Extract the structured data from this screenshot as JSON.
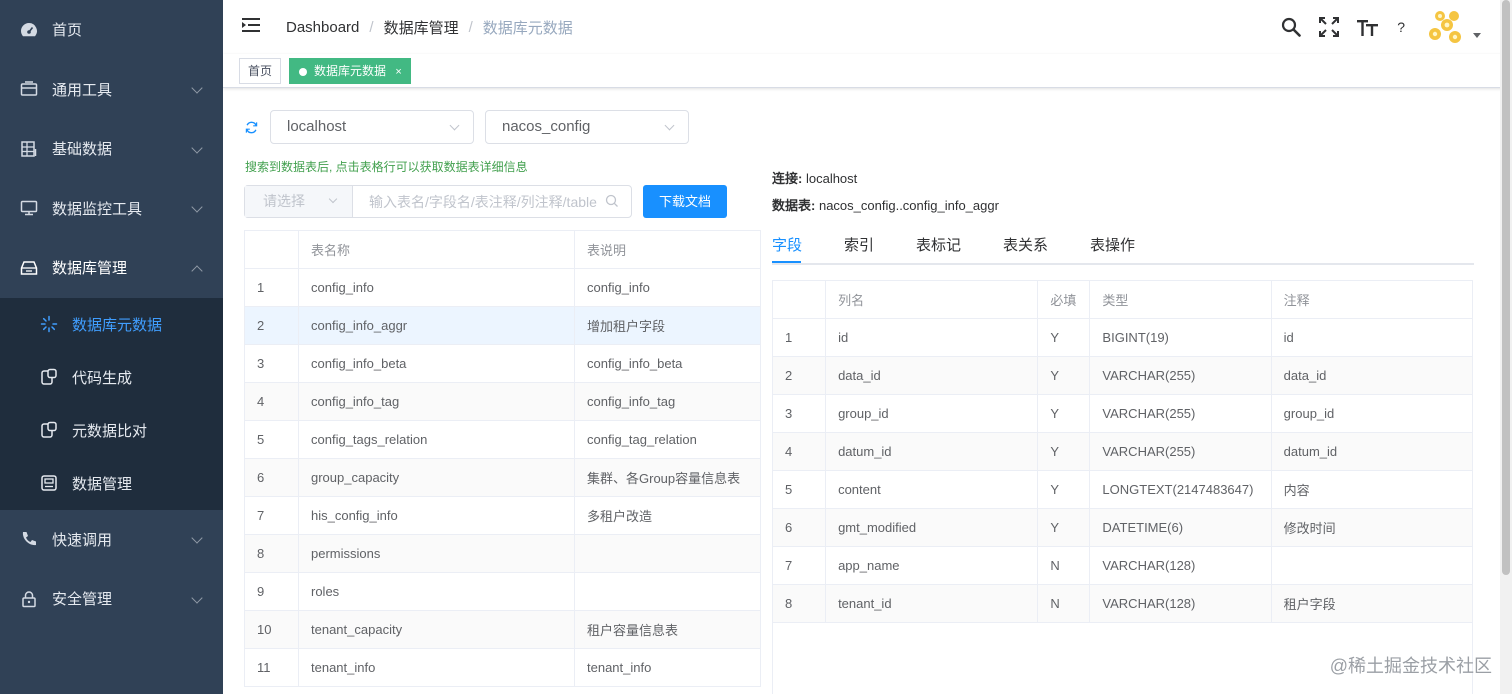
{
  "sidebar": {
    "items": [
      {
        "label": "首页",
        "icon": "dashboard-icon"
      },
      {
        "label": "通用工具",
        "icon": "tools-icon"
      },
      {
        "label": "基础数据",
        "icon": "table-icon"
      },
      {
        "label": "数据监控工具",
        "icon": "monitor-icon"
      },
      {
        "label": "数据库管理",
        "icon": "database-icon"
      }
    ],
    "subitems": [
      {
        "label": "数据库元数据",
        "icon": "sparkle-icon"
      },
      {
        "label": "代码生成",
        "icon": "code-icon"
      },
      {
        "label": "元数据比对",
        "icon": "compare-icon"
      },
      {
        "label": "数据管理",
        "icon": "data-icon"
      }
    ],
    "bottom_items": [
      {
        "label": "快速调用",
        "icon": "phone-icon"
      },
      {
        "label": "安全管理",
        "icon": "lock-icon"
      }
    ]
  },
  "header": {
    "breadcrumb": [
      "Dashboard",
      "数据库管理",
      "数据库元数据"
    ],
    "sep": "/",
    "help": "?"
  },
  "tags": {
    "home": "首页",
    "active": "数据库元数据",
    "close": "×"
  },
  "filters": {
    "connection": "localhost",
    "database": "nacos_config",
    "hint": "搜索到数据表后, 点击表格行可以获取数据表详细信息",
    "search_type_placeholder": "请选择",
    "search_placeholder": "输入表名/字段名/表注释/列注释/table",
    "download_label": "下载文档"
  },
  "left_table": {
    "headers": [
      "",
      "表名称",
      "表说明"
    ],
    "rows": [
      [
        "1",
        "config_info",
        "config_info"
      ],
      [
        "2",
        "config_info_aggr",
        "增加租户字段"
      ],
      [
        "3",
        "config_info_beta",
        "config_info_beta"
      ],
      [
        "4",
        "config_info_tag",
        "config_info_tag"
      ],
      [
        "5",
        "config_tags_relation",
        "config_tag_relation"
      ],
      [
        "6",
        "group_capacity",
        "集群、各Group容量信息表"
      ],
      [
        "7",
        "his_config_info",
        "多租户改造"
      ],
      [
        "8",
        "permissions",
        ""
      ],
      [
        "9",
        "roles",
        ""
      ],
      [
        "10",
        "tenant_capacity",
        "租户容量信息表"
      ],
      [
        "11",
        "tenant_info",
        "tenant_info"
      ]
    ]
  },
  "detail": {
    "connection_label": "连接:",
    "connection_value": "localhost",
    "table_label": "数据表:",
    "table_value": "nacos_config..config_info_aggr",
    "tabs": [
      "字段",
      "索引",
      "表标记",
      "表关系",
      "表操作"
    ]
  },
  "right_table": {
    "headers": [
      "",
      "列名",
      "必填",
      "类型",
      "注释"
    ],
    "rows": [
      [
        "1",
        "id",
        "Y",
        "BIGINT(19)",
        "id"
      ],
      [
        "2",
        "data_id",
        "Y",
        "VARCHAR(255)",
        "data_id"
      ],
      [
        "3",
        "group_id",
        "Y",
        "VARCHAR(255)",
        "group_id"
      ],
      [
        "4",
        "datum_id",
        "Y",
        "VARCHAR(255)",
        "datum_id"
      ],
      [
        "5",
        "content",
        "Y",
        "LONGTEXT(2147483647)",
        "内容"
      ],
      [
        "6",
        "gmt_modified",
        "Y",
        "DATETIME(6)",
        "修改时间"
      ],
      [
        "7",
        "app_name",
        "N",
        "VARCHAR(128)",
        ""
      ],
      [
        "8",
        "tenant_id",
        "N",
        "VARCHAR(128)",
        "租户字段"
      ]
    ]
  },
  "watermark": "@稀土掘金技术社区",
  "colors": {
    "sidebar": "#304156",
    "submenu": "#1f2d3d",
    "accent": "#1890ff",
    "tag_active": "#42b983"
  }
}
